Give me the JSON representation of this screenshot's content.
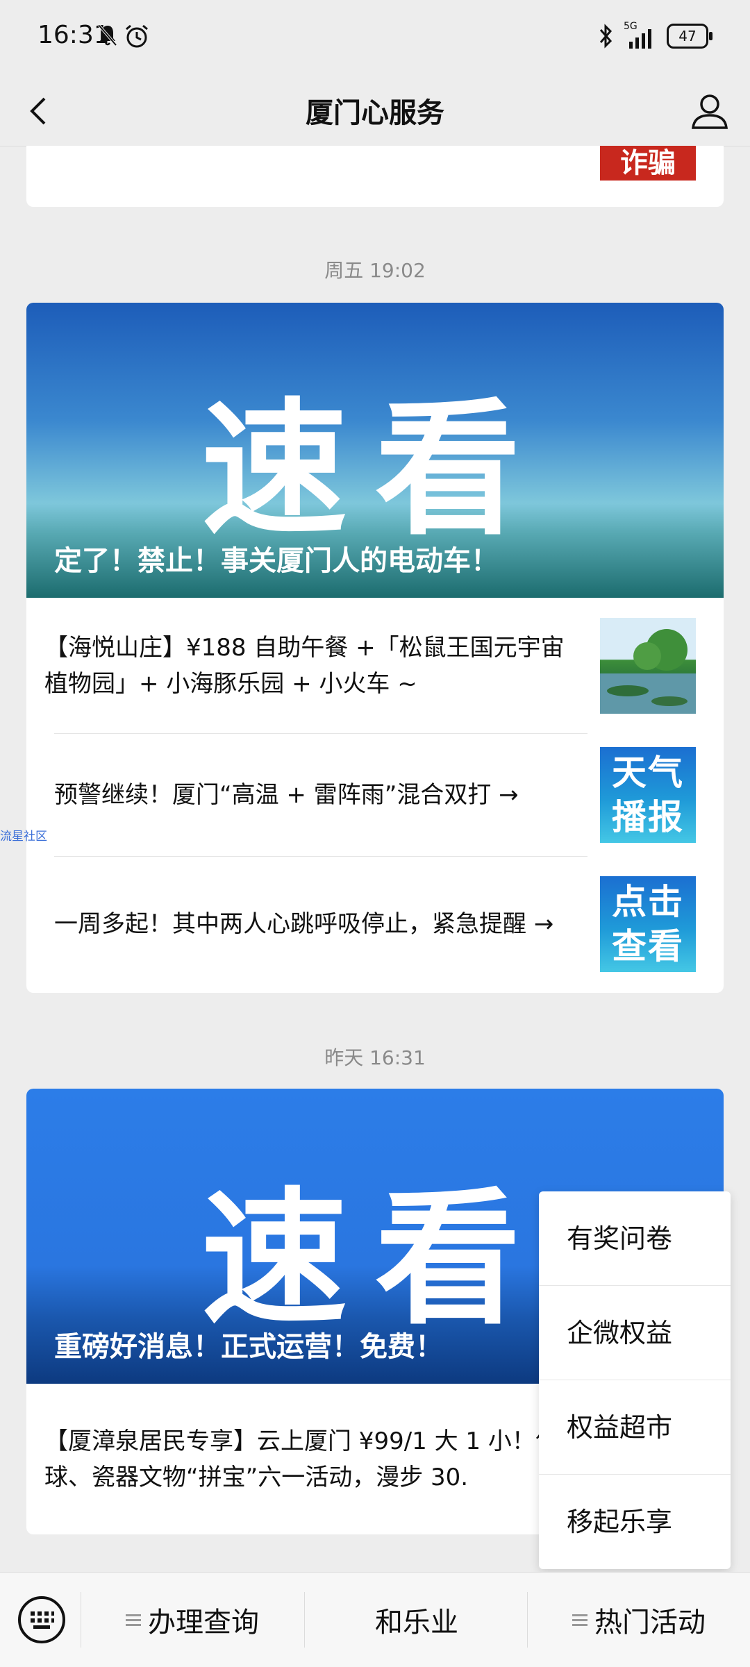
{
  "status_bar": {
    "time": "16:31",
    "battery": "47",
    "network": "5G"
  },
  "header": {
    "title": "厦门心服务"
  },
  "top_card": {
    "thumb_text": "诈骗"
  },
  "group1": {
    "timestamp": "周五 19:02",
    "hero_big": "速看",
    "hero_caption": "定了！禁止！事关厦门人的电动车！",
    "articles": [
      {
        "text": "【海悦山庄】¥188 自助午餐 +「松鼠王国元宇宙植物园」+ 小海豚乐园 + 小火车 ~"
      },
      {
        "text": "预警继续！厦门“高温 + 雷阵雨”混合双打 →",
        "thumb": "天气播报"
      },
      {
        "text": "一周多起！其中两人心跳呼吸停止，紧急提醒 →",
        "thumb": "点击查看"
      }
    ]
  },
  "group2": {
    "timestamp": "昨天 16:31",
    "hero_big": "速看",
    "hero_caption": "重磅好消息！正式运营！免费！",
    "articles": [
      {
        "text": "【厦漳泉居民专享】云上厦门 ¥99/1 大 1 小！气球、瓷器文物“拼宝”六一活动，漫步 30."
      }
    ]
  },
  "side_label": "流星社区",
  "popup_menu": {
    "items": [
      "有奖问卷",
      "企微权益",
      "权益超市",
      "移起乐享"
    ]
  },
  "bottom_menu": {
    "items": [
      "办理查询",
      "和乐业",
      "热门活动"
    ]
  }
}
